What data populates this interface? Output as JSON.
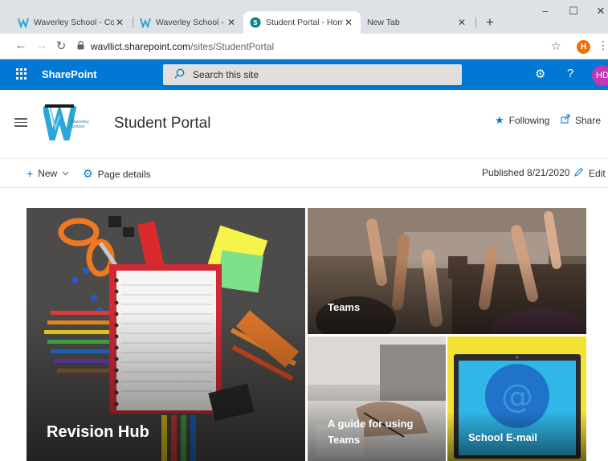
{
  "browser": {
    "tabs": [
      {
        "title": "Waverley School - Cov",
        "active": false
      },
      {
        "title": "Waverley School - Cov",
        "active": false
      },
      {
        "title": "Student Portal - Home",
        "active": true
      },
      {
        "title": "New Tab",
        "active": false
      }
    ],
    "new_tab_glyph": "+",
    "window_controls": {
      "minimize": "–",
      "maximize": "☐",
      "close": "✕"
    },
    "address": {
      "host": "wavllict.sharepoint.com",
      "path": "/sites/StudentPortal"
    },
    "profile_initial": "H",
    "accent": "#e8710a"
  },
  "suitebar": {
    "brand": "SharePoint",
    "search_placeholder": "Search this site",
    "user_initials": "HD",
    "color": "#0078d4"
  },
  "site": {
    "title": "Student Portal",
    "logo_text": [
      "Waverley",
      "School"
    ],
    "following_label": "Following",
    "share_label": "Share"
  },
  "commandbar": {
    "new_label": "New",
    "page_details_label": "Page details",
    "published_text": "Published 8/21/2020",
    "edit_label": "Edit"
  },
  "hero": [
    {
      "caption": "Revision Hub"
    },
    {
      "caption": "Teams"
    },
    {
      "caption": "A guide for using Teams"
    },
    {
      "caption": "School E-mail"
    }
  ]
}
